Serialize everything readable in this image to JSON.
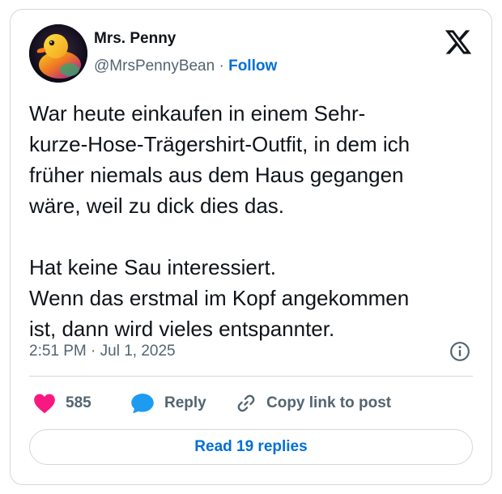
{
  "author": {
    "name": "Mrs. Penny",
    "handle": "@MrsPennyBean",
    "separator": "·",
    "follow_label": "Follow",
    "avatar_icon": "rubber-duck-avatar"
  },
  "platform_icon": "x-logo-icon",
  "tweet": {
    "lines": [
      "War heute einkaufen in einem Sehr-",
      "kurze-Hose-Trägershirt-Outfit, in dem ich",
      "früher niemals aus dem Haus gegangen",
      "wäre, weil zu dick dies das.",
      "",
      "Hat keine Sau interessiert.",
      "Wenn das erstmal im Kopf angekommen",
      "ist, dann wird vieles entspannter."
    ],
    "timestamp": "2:51 PM · Jul 1, 2025"
  },
  "actions": {
    "like_count": "585",
    "reply_label": "Reply",
    "copy_link_label": "Copy link to post"
  },
  "read_replies_label": "Read 19 replies",
  "colors": {
    "like": "#f91880",
    "reply": "#1d9bf0",
    "link": "#006fd6",
    "muted": "#536471",
    "text": "#0f1419",
    "border": "#cfd9de"
  }
}
